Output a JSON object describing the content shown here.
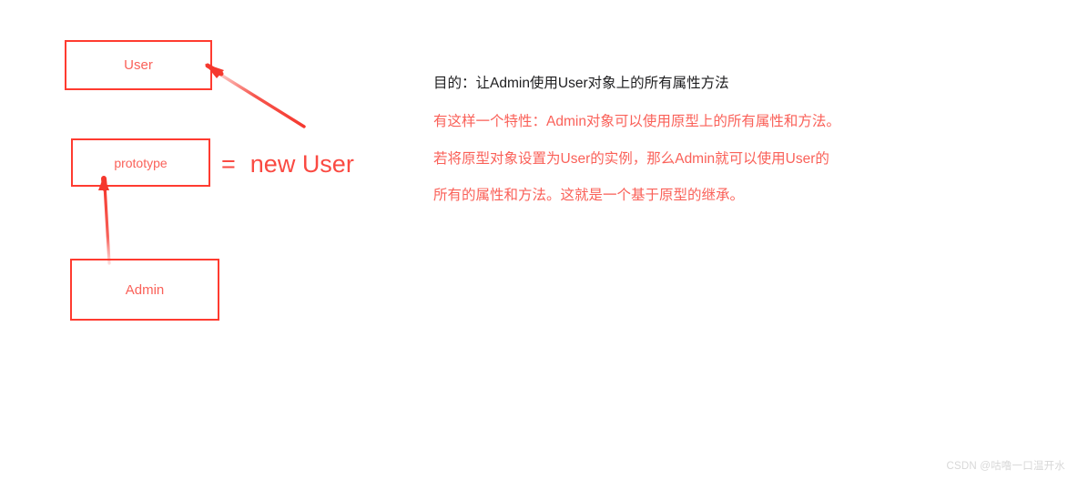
{
  "diagram": {
    "boxes": [
      {
        "id": "user",
        "label": "User"
      },
      {
        "id": "prototype",
        "label": "prototype"
      },
      {
        "id": "admin",
        "label": "Admin"
      }
    ],
    "equation": {
      "sign": "=",
      "expression": "new User"
    },
    "arrows": [
      {
        "id": "prototype-to-user",
        "from": "prototype-equation",
        "to": "user-box"
      },
      {
        "id": "admin-to-prototype",
        "from": "admin-box",
        "to": "prototype-box"
      }
    ],
    "colors": {
      "box_border": "#ff3b30",
      "box_label": "#fa6159",
      "arrow": "#f5382e",
      "equation_text": "#fa4a42"
    }
  },
  "notes": {
    "lines": [
      {
        "text": "目的：让Admin使用User对象上的所有属性方法",
        "color": "dark"
      },
      {
        "text": "有这样一个特性：Admin对象可以使用原型上的所有属性和方法。",
        "color": "red"
      },
      {
        "text": "若将原型对象设置为User的实例，那么Admin就可以使用User的",
        "color": "red"
      },
      {
        "text": "所有的属性和方法。这就是一个基于原型的继承。",
        "color": "red"
      }
    ],
    "colors": {
      "dark": "#1d1d1f",
      "red": "#fa6159"
    }
  },
  "watermark": {
    "text": "CSDN @咕噜一口温开水",
    "color": "#d8d8d8"
  }
}
